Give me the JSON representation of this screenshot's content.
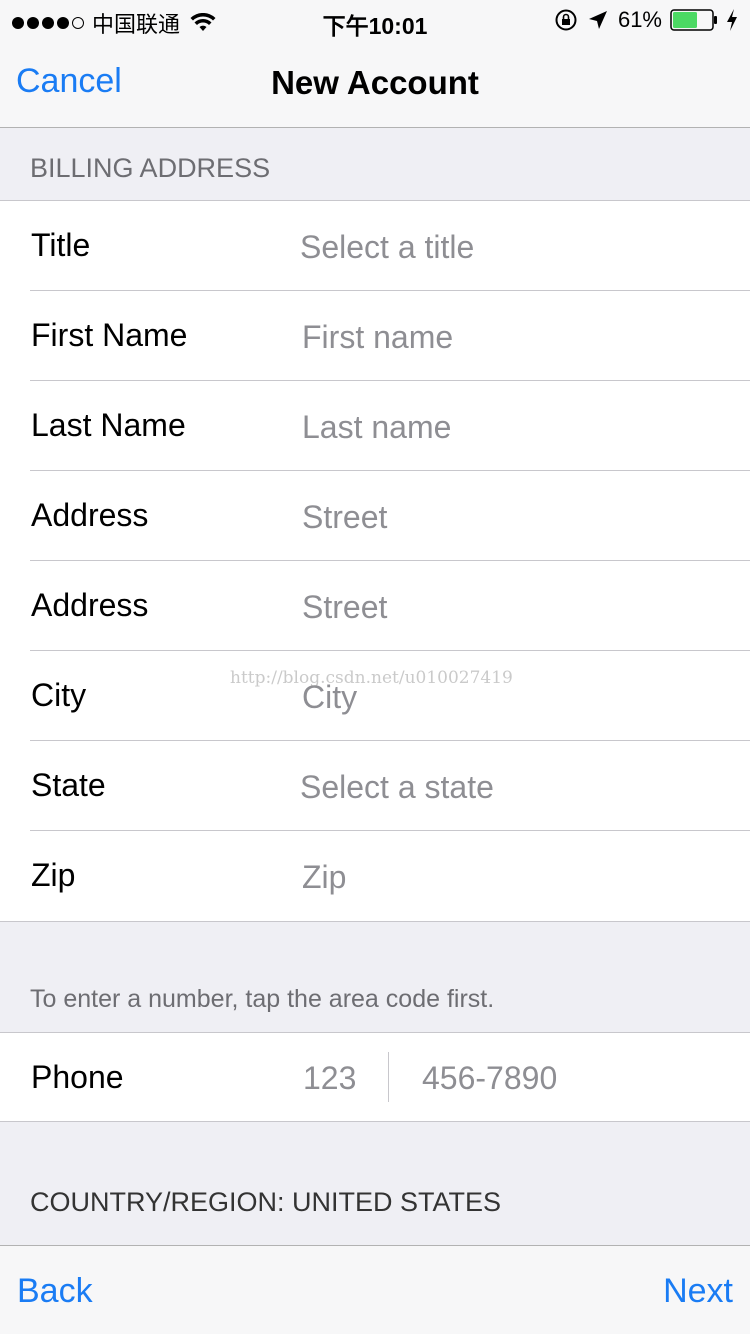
{
  "status_bar": {
    "carrier": "中国联通",
    "time": "下午10:01",
    "battery": "61%"
  },
  "nav": {
    "cancel": "Cancel",
    "title": "New Account"
  },
  "billing": {
    "header": "BILLING ADDRESS",
    "rows": [
      {
        "label": "Title",
        "placeholder": "Select a title"
      },
      {
        "label": "First Name",
        "placeholder": "First name"
      },
      {
        "label": "Last Name",
        "placeholder": "Last name"
      },
      {
        "label": "Address",
        "placeholder": "Street"
      },
      {
        "label": "Address",
        "placeholder": "Street"
      },
      {
        "label": "City",
        "placeholder": "City"
      },
      {
        "label": "State",
        "placeholder": "Select a state"
      },
      {
        "label": "Zip",
        "placeholder": "Zip"
      }
    ]
  },
  "phone": {
    "note": "To enter a number, tap the area code first.",
    "label": "Phone",
    "area_placeholder": "123",
    "number_placeholder": "456-7890"
  },
  "country": {
    "header": "COUNTRY/REGION: UNITED STATES"
  },
  "toolbar": {
    "back": "Back",
    "next": "Next"
  },
  "watermark": "http://blog.csdn.net/u010027419",
  "colors": {
    "accent": "#1a7cf4",
    "placeholder": "#8e8e93",
    "background": "#efeff4",
    "battery_fill": "#4cd964"
  }
}
